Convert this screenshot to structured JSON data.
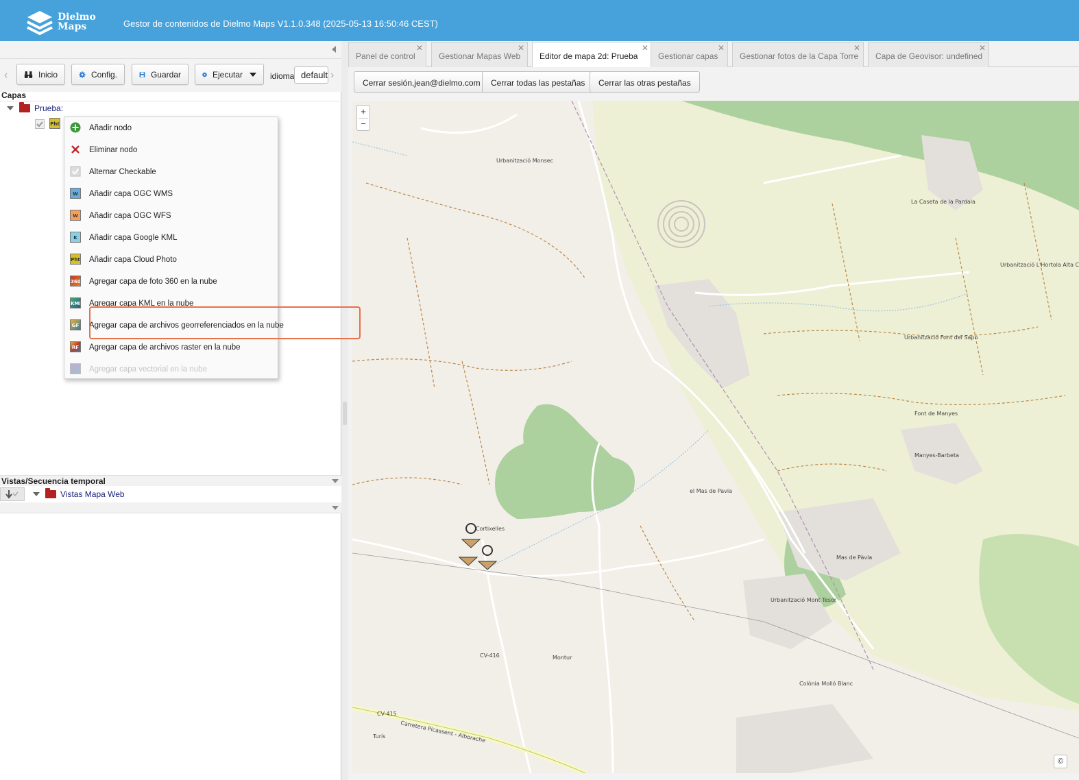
{
  "header": {
    "logo_line1": "Dielmo",
    "logo_line2": "Maps",
    "title": "Gestor de contenidos de Dielmo Maps V1.1.0.348 (2025-05-13 16:50:46 CEST)"
  },
  "toolbar": {
    "inicio": "Inicio",
    "config": "Config.",
    "guardar": "Guardar",
    "ejecutar": "Ejecutar",
    "idioma_label": "idioma:",
    "idioma_value": "default"
  },
  "layers_panel": {
    "title": "Capas",
    "root_label": "Prueba:",
    "child_icon_text": "Pht"
  },
  "context_menu": {
    "items": [
      {
        "label": "Añadir nodo",
        "icon": "add-node-icon",
        "disabled": false
      },
      {
        "label": "Eliminar nodo",
        "icon": "delete-node-icon",
        "disabled": false
      },
      {
        "label": "Alternar Checkable",
        "icon": "checkbox-icon",
        "disabled": false
      },
      {
        "label": "Añadir capa OGC WMS",
        "icon": "wms-layer-icon",
        "disabled": false
      },
      {
        "label": "Añadir capa OGC WFS",
        "icon": "wfs-layer-icon",
        "disabled": false
      },
      {
        "label": "Añadir capa Google KML",
        "icon": "kml-layer-icon",
        "disabled": false
      },
      {
        "label": "Añadir capa Cloud Photo",
        "icon": "cloud-photo-icon",
        "disabled": false
      },
      {
        "label": "Agregar capa de foto 360 en la nube",
        "icon": "photo-360-icon",
        "disabled": false
      },
      {
        "label": "Agregar capa KML en la nube",
        "icon": "cloud-kml-icon",
        "disabled": false
      },
      {
        "label": "Agregar capa de archivos georreferenciados en la nube",
        "icon": "georef-files-icon",
        "disabled": false
      },
      {
        "label": "Agregar capa de archivos raster en la nube",
        "icon": "raster-files-icon",
        "disabled": false
      },
      {
        "label": "Agregar capa vectorial en la nube",
        "icon": "vector-layer-icon",
        "disabled": true
      }
    ]
  },
  "vistas_panel": {
    "title": "Vistas/Secuencia temporal",
    "root_label": "Vistas Mapa Web"
  },
  "tabs": [
    {
      "label": "Panel de control",
      "active": false
    },
    {
      "label": "Gestionar Mapas Web",
      "active": false
    },
    {
      "label": "Editor de mapa 2d: Prueba",
      "active": true
    },
    {
      "label": "Gestionar capas",
      "active": false
    },
    {
      "label": "Gestionar fotos de la Capa Torre",
      "active": false
    },
    {
      "label": "Capa de Geovisor: undefined",
      "active": false
    }
  ],
  "tab_actions": {
    "logout": "Cerrar sesión,jean@dielmo.com",
    "close_all": "Cerrar todas las pestañas",
    "close_others": "Cerrar las otras pestañas"
  },
  "map": {
    "zoom_in": "+",
    "zoom_out": "−",
    "attribution": "©",
    "labels": {
      "urbanizacion_monsec": "Urbanització Monsec",
      "la_caseta": "La Caseta de la Pardala",
      "urb_hortola": "Urbanització L'Hortola Alta Camp",
      "urb_font_sapo": "Urbanització Font del Sapo",
      "font_manyes": "Font de Manyes",
      "manyes_barbeta": "Manyes-Barbeta",
      "el_mas_pavia": "el Mas de Pavia",
      "mas_pavia": "Mas de Pàvia",
      "urb_mont_tesor": "Urbanització Mont Tesor",
      "montur": "Montur",
      "colonia_mollo": "Colònia Molló Blanc",
      "cortixelles": "Cortixelles",
      "cv416": "CV-416",
      "cv415": "CV-415",
      "carretera": "Carretera Picassent - Alborache",
      "turis": "Turís"
    }
  },
  "colors": {
    "header": "#47a2dc",
    "highlight": "#e8704a",
    "folder": "#b22222",
    "tree_link": "#1a237e"
  }
}
